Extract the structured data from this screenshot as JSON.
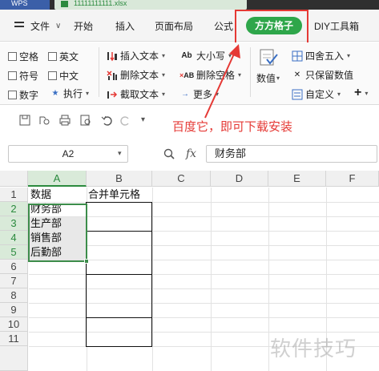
{
  "titlebar": {
    "app_tab": "WPS",
    "doc_tab": "11111111111.xlsx"
  },
  "menu": {
    "file": "文件",
    "file_caret": "∨",
    "start": "开始",
    "insert": "插入",
    "layout": "页面布局",
    "formula": "公式",
    "ffgz": "方方格子",
    "diy": "DIY工具箱"
  },
  "ribbon": {
    "checkboxes": [
      "空格",
      "英文",
      "符号",
      "中文",
      "数字",
      "执行"
    ],
    "text_group": [
      "插入文本",
      "删除文本",
      "截取文本"
    ],
    "case_group": [
      "大小写",
      "删除空格",
      "更多"
    ],
    "value_label": "数值",
    "round_group": [
      "四舍五入",
      "只保留数值",
      "自定义"
    ],
    "plus": "+"
  },
  "annotation": "百度它，即可下载安装",
  "formula_bar": {
    "name_box": "A2",
    "fx": "fx",
    "value": "财务部"
  },
  "sheet": {
    "columns": [
      "A",
      "B",
      "C",
      "D",
      "E",
      "F"
    ],
    "rows": [
      "1",
      "2",
      "3",
      "4",
      "5",
      "6",
      "7",
      "8",
      "9",
      "10",
      "11"
    ],
    "a_values": [
      "数据",
      "财务部",
      "生产部",
      "销售部",
      "后勤部"
    ],
    "b1": "合并单元格"
  },
  "watermark": "软件技巧",
  "colors": {
    "accent": "#2ea64a",
    "highlight": "#e53935",
    "selection": "#3c8d4a"
  }
}
